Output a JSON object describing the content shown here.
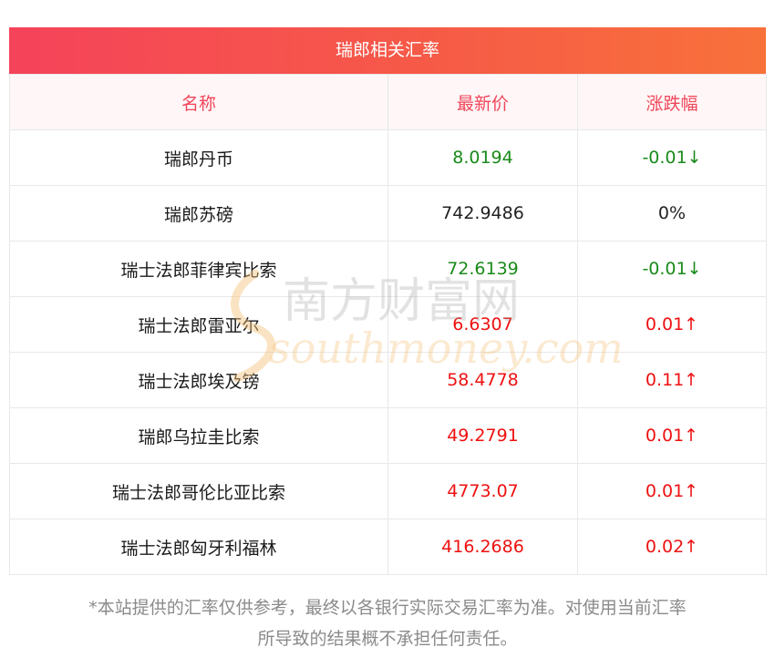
{
  "header": {
    "title": "瑞郎相关汇率"
  },
  "table": {
    "columns": [
      "名称",
      "最新价",
      "涨跌幅"
    ],
    "rows": [
      {
        "name": "瑞郎丹币",
        "price": "8.0194",
        "change": "-0.01↓",
        "dir": "down"
      },
      {
        "name": "瑞郎苏磅",
        "price": "742.9486",
        "change": "0%",
        "dir": "flat"
      },
      {
        "name": "瑞士法郎菲律宾比索",
        "price": "72.6139",
        "change": "-0.01↓",
        "dir": "down"
      },
      {
        "name": "瑞士法郎雷亚尔",
        "price": "6.6307",
        "change": "0.01↑",
        "dir": "up"
      },
      {
        "name": "瑞士法郎埃及镑",
        "price": "58.4778",
        "change": "0.11↑",
        "dir": "up"
      },
      {
        "name": "瑞郎乌拉圭比索",
        "price": "49.2791",
        "change": "0.01↑",
        "dir": "up"
      },
      {
        "name": "瑞士法郎哥伦比亚比索",
        "price": "4773.07",
        "change": "0.01↑",
        "dir": "up"
      },
      {
        "name": "瑞士法郎匈牙利福林",
        "price": "416.2686",
        "change": "0.02↑",
        "dir": "up"
      }
    ]
  },
  "watermark": {
    "cn": "南方财富网",
    "en": "southmoney.com"
  },
  "footer": {
    "line1": "*本站提供的汇率仅供参考，最终以各银行实际交易汇率为准。对使用当前汇率",
    "line2": "所导致的结果概不承担任何责任。"
  },
  "colors": {
    "header_start": "#f5435a",
    "header_end": "#f8713a",
    "column_header_text": "#f0465a",
    "up": "#ee1111",
    "down": "#1a8a1a"
  }
}
